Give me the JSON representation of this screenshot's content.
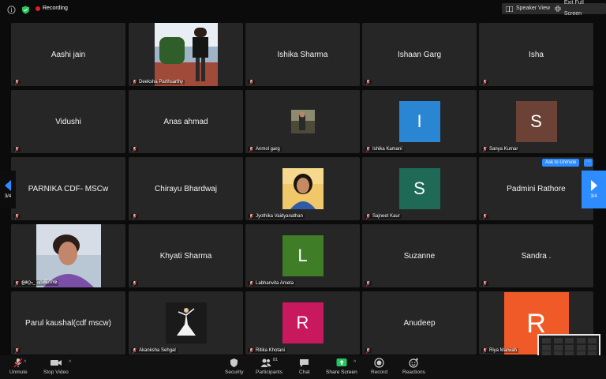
{
  "topbar": {
    "recording_label": "Recording",
    "speaker_view_label": "Speaker View",
    "exit_full_screen_label": "Exit Full Screen"
  },
  "pagination": {
    "left_label": "3/4",
    "right_label": "3/4"
  },
  "ask_to_unmute": "Ask to Unmute",
  "more_label": "···",
  "tiles": [
    {
      "name": "Aashi jain",
      "type": "name"
    },
    {
      "name": "Deeksha Parthsarthy",
      "type": "photo",
      "photo": "standing-person"
    },
    {
      "name": "Ishika Sharma",
      "type": "name"
    },
    {
      "name": "Ishaan Garg",
      "type": "name"
    },
    {
      "name": "Isha",
      "type": "name"
    },
    {
      "name": "Vidushi",
      "type": "name"
    },
    {
      "name": "Anas ahmad",
      "type": "name"
    },
    {
      "name": "Anmol garg",
      "type": "photo",
      "photo": "small-photo"
    },
    {
      "name": "Ishika Kamani",
      "type": "avatar",
      "initial": "I",
      "color": "#2a86d3"
    },
    {
      "name": "Sanya Kumar",
      "type": "avatar",
      "initial": "S",
      "color": "#6b4235"
    },
    {
      "name": "PARNIKA CDF- MSCw",
      "type": "name"
    },
    {
      "name": "Chirayu Bhardwaj",
      "type": "name"
    },
    {
      "name": "Jyothika Vaidyanathan",
      "type": "photo",
      "photo": "smiling-person"
    },
    {
      "name": "Sajneet Kaur",
      "type": "avatar",
      "initial": "S",
      "color": "#1e6a57"
    },
    {
      "name": "Padmini Rathore",
      "type": "name"
    },
    {
      "name": "ളമറ്റം_ ഹരിഗ്ന്നു",
      "type": "photo",
      "photo": "young-man"
    },
    {
      "name": "Khyati Sharma",
      "type": "name"
    },
    {
      "name": "Labhanvita Ameta",
      "type": "avatar",
      "initial": "L",
      "color": "#3f7d27"
    },
    {
      "name": "Suzanne",
      "type": "name"
    },
    {
      "name": "Sandra .",
      "type": "name"
    },
    {
      "name": "Parul kaushal(cdf mscw)",
      "type": "name"
    },
    {
      "name": "Akanksha Sehgal",
      "type": "photo",
      "photo": "dancer"
    },
    {
      "name": "Ritika Khotani",
      "type": "avatar",
      "initial": "R",
      "color": "#c8185e"
    },
    {
      "name": "Anudeep",
      "type": "name"
    },
    {
      "name": "Riya Marwah",
      "type": "avatar",
      "initial": "R",
      "color": "#f05a28"
    }
  ],
  "toolbar": {
    "unmute": "Unmute",
    "stop_video": "Stop Video",
    "security": "Security",
    "participants": "Participants",
    "participants_count": "81",
    "chat": "Chat",
    "share_screen": "Share Screen",
    "record": "Record",
    "reactions": "Reactions"
  },
  "colors": {
    "accent": "#2d8cff",
    "share_green": "#23c55e",
    "muted_red": "#e02020"
  }
}
